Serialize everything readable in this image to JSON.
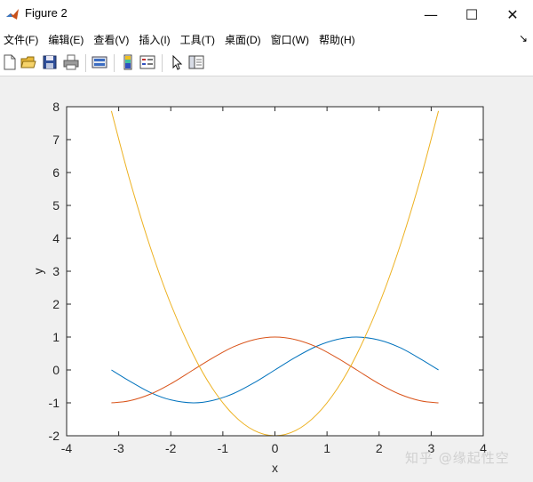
{
  "window": {
    "title": "Figure 2",
    "minimize_glyph": "—",
    "maximize_glyph": "☐",
    "close_glyph": "✕"
  },
  "menu": {
    "items": [
      {
        "label": "文件(F)"
      },
      {
        "label": "编辑(E)"
      },
      {
        "label": "查看(V)"
      },
      {
        "label": "插入(I)"
      },
      {
        "label": "工具(T)"
      },
      {
        "label": "桌面(D)"
      },
      {
        "label": "窗口(W)"
      },
      {
        "label": "帮助(H)"
      }
    ],
    "dock_arrow": "↘"
  },
  "toolbar": {
    "icons": [
      "new-figure-icon",
      "open-file-icon",
      "save-icon",
      "print-icon",
      "link-plot-icon",
      "insert-colorbar-icon",
      "insert-legend-icon",
      "edit-plot-arrow-icon",
      "property-inspector-icon"
    ]
  },
  "watermark": "知乎 @缘起性空",
  "colors": {
    "sin": "#0072bd",
    "cos": "#d95319",
    "poly": "#edb120"
  },
  "chart_data": {
    "type": "line",
    "xlabel": "x",
    "ylabel": "y",
    "xlim": [
      -4,
      4
    ],
    "ylim": [
      -2,
      8
    ],
    "xticks": [
      -4,
      -3,
      -2,
      -1,
      0,
      1,
      2,
      3,
      4
    ],
    "yticks": [
      -2,
      -1,
      0,
      1,
      2,
      3,
      4,
      5,
      6,
      7,
      8
    ],
    "grid": false,
    "legend": "none",
    "x": [
      -3.14,
      -2.8,
      -2.4,
      -2.0,
      -1.57,
      -1.2,
      -0.8,
      -0.4,
      0.0,
      0.4,
      0.8,
      1.2,
      1.57,
      2.0,
      2.4,
      2.8,
      3.14
    ],
    "series": [
      {
        "values": [
          0.0,
          -0.33,
          -0.68,
          -0.91,
          -1.0,
          -0.93,
          -0.72,
          -0.39,
          0.0,
          0.39,
          0.72,
          0.93,
          1.0,
          0.91,
          0.68,
          0.33,
          0.0
        ]
      },
      {
        "values": [
          -1.0,
          -0.94,
          -0.74,
          -0.42,
          0.0,
          0.36,
          0.7,
          0.92,
          1.0,
          0.92,
          0.7,
          0.36,
          0.0,
          -0.42,
          -0.74,
          -0.94,
          -1.0
        ]
      },
      {
        "values": [
          7.87,
          5.84,
          3.76,
          2.0,
          0.47,
          -0.56,
          -1.36,
          -1.84,
          -2.0,
          -1.84,
          -1.36,
          -0.56,
          0.47,
          2.0,
          3.76,
          5.84,
          7.87
        ]
      }
    ]
  }
}
